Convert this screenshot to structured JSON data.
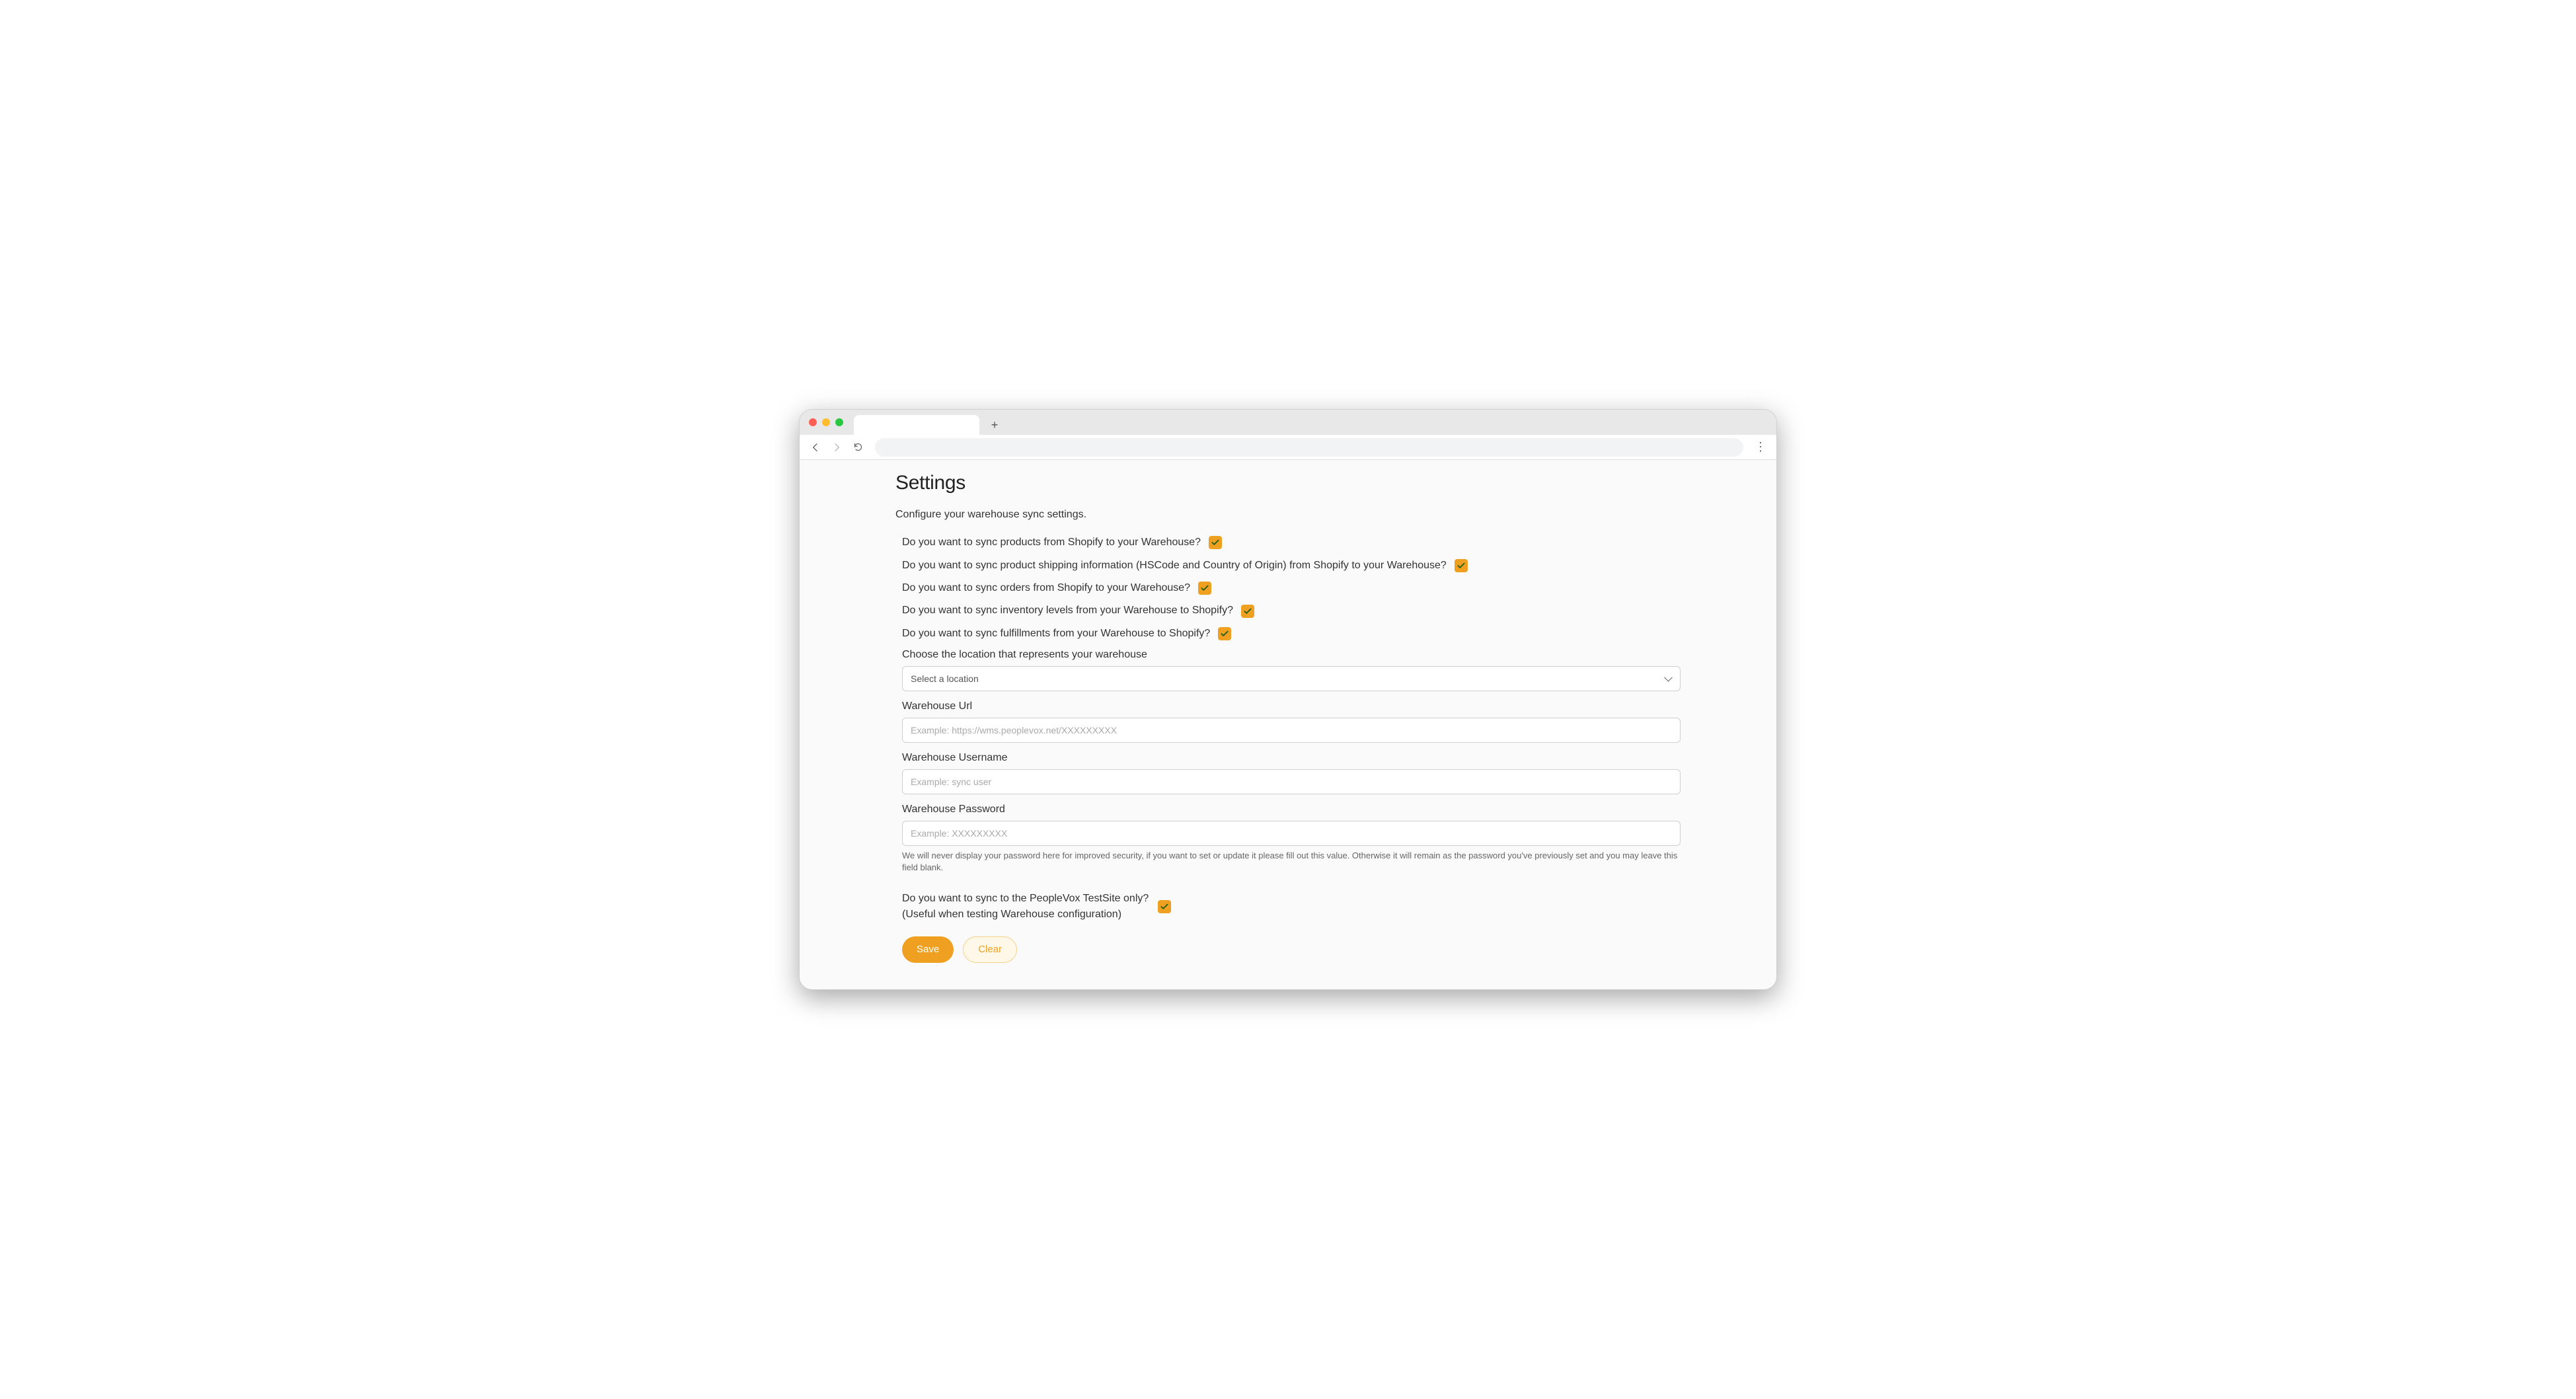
{
  "page": {
    "title": "Settings",
    "subtitle": "Configure your warehouse sync settings."
  },
  "toggles": [
    {
      "label": "Do you want to sync products from Shopify to your Warehouse?",
      "checked": true
    },
    {
      "label": "Do you want to sync product shipping information (HSCode and Country of Origin) from Shopify to your Warehouse?",
      "checked": true
    },
    {
      "label": "Do you want to sync orders from Shopify to your Warehouse?",
      "checked": true
    },
    {
      "label": "Do you want to sync inventory levels from your Warehouse to Shopify?",
      "checked": true
    },
    {
      "label": "Do you want to sync fulfillments from your Warehouse to Shopify?",
      "checked": true
    }
  ],
  "location": {
    "label": "Choose the location that represents your warehouse",
    "placeholder": "Select a location"
  },
  "url": {
    "label": "Warehouse Url",
    "placeholder": "Example: https://wms.peoplevox.net/XXXXXXXXX"
  },
  "username": {
    "label": "Warehouse Username",
    "placeholder": "Example: sync user"
  },
  "password": {
    "label": "Warehouse Password",
    "placeholder": "Example: XXXXXXXXX",
    "help": "We will never display your password here for improved security, if you want to set or update it please fill out this value. Otherwise it will remain as the password you've previously set and you may leave this field blank."
  },
  "testsite": {
    "line1": "Do you want to sync to the PeopleVox TestSite only?",
    "line2": "(Useful when testing Warehouse configuration)",
    "checked": true
  },
  "buttons": {
    "save": "Save",
    "clear": "Clear"
  },
  "browser": {
    "new_tab": "+"
  }
}
